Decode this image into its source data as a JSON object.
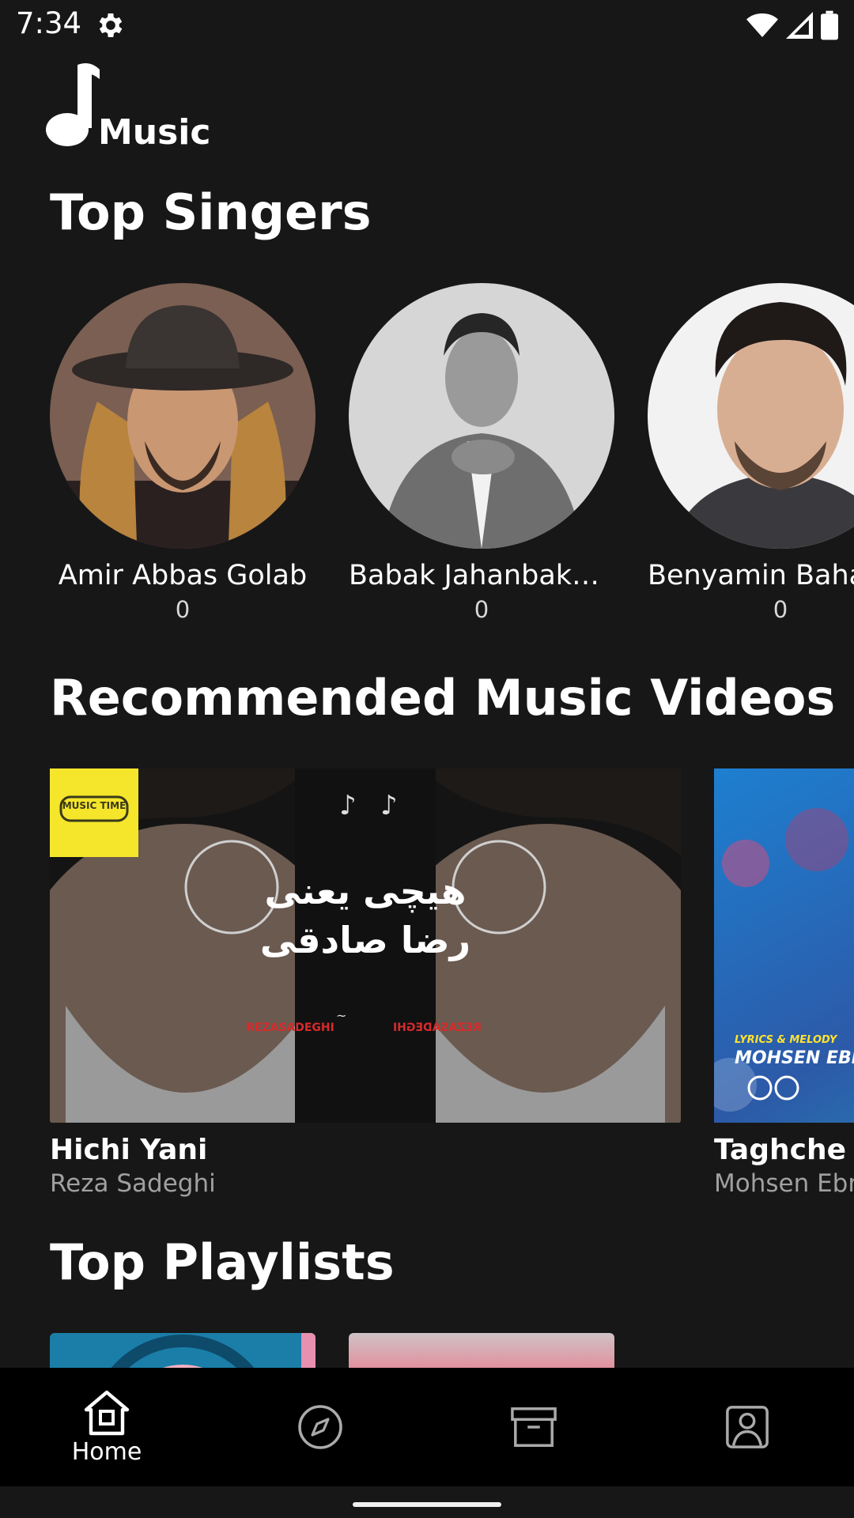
{
  "status_bar": {
    "time": "7:34"
  },
  "app": {
    "logo_text": "Music"
  },
  "sections": {
    "singers_title": "Top Singers",
    "videos_title": "Recommended Music Videos",
    "playlists_title": "Top Playlists"
  },
  "singers": [
    {
      "name": "Amir Abbas Golab",
      "count": "0"
    },
    {
      "name": "Babak Jahanbakhsh",
      "count": "0"
    },
    {
      "name": "Benyamin Bahadori",
      "count": "0"
    }
  ],
  "videos": [
    {
      "title": "Hichi Yani",
      "artist": "Reza Sadeghi",
      "thumb_badge": "MUSIC TIME",
      "thumb_title_line1": "هیچی یعنی",
      "thumb_title_line2": "رضا صادقی",
      "thumb_brand_left": "REZASADEGHI",
      "thumb_brand_right": "REZASADEGHI"
    },
    {
      "title": "Taghche B",
      "artist": "Mohsen Ebr",
      "thumb_caption_small": "LYRICS & MELODY",
      "thumb_caption_big": "MOHSEN EBRAH"
    }
  ],
  "bottom_nav": [
    {
      "label": "Home",
      "icon": "home-icon",
      "active": true
    },
    {
      "label": "",
      "icon": "compass-icon",
      "active": false
    },
    {
      "label": "",
      "icon": "archive-icon",
      "active": false
    },
    {
      "label": "",
      "icon": "profile-icon",
      "active": false
    }
  ],
  "colors": {
    "background": "#171717",
    "nav_background": "#000000",
    "text_primary": "#ffffff",
    "text_secondary": "#a0a0a0",
    "badge_yellow": "#f5e52b"
  }
}
